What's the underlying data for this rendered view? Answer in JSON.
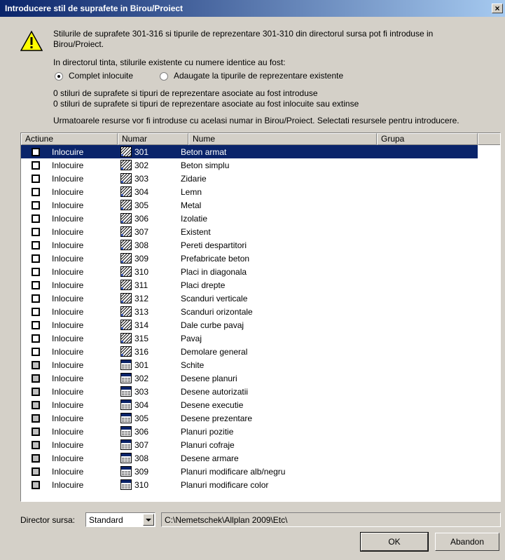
{
  "window": {
    "title": "Introducere stil de suprafete in Birou/Proiect",
    "close": "×"
  },
  "info": {
    "line1": "Stilurile de suprafete 301-316 si tipurile de reprezentare 301-310 din directorul sursa pot fi introduse in",
    "line2": "Birou/Proiect.",
    "line3": "In directorul tinta, stilurile existente cu numere identice au fost:",
    "radio1": "Complet inlocuite",
    "radio2": "Adaugate la tipurile de reprezentare existente",
    "status1": "0 stiluri de suprafete si tipuri de reprezentare asociate au fost introduse",
    "status2": "0 stiluri de suprafete si tipuri de reprezentare asociate au fost inlocuite sau extinse",
    "prompt": "Urmatoarele resurse vor fi introduse cu acelasi numar in Birou/Proiect. Selectati resursele pentru introducere."
  },
  "table": {
    "columns": [
      "Actiune",
      "Numar",
      "Nume",
      "Grupa"
    ],
    "rows": [
      {
        "action": "Inlocuire",
        "number": "301",
        "name": "Beton armat",
        "icon": "hatch-icon"
      },
      {
        "action": "Inlocuire",
        "number": "302",
        "name": "Beton simplu",
        "icon": "hatch-icon"
      },
      {
        "action": "Inlocuire",
        "number": "303",
        "name": "Zidarie",
        "icon": "hatch-icon"
      },
      {
        "action": "Inlocuire",
        "number": "304",
        "name": "Lemn",
        "icon": "hatch-icon"
      },
      {
        "action": "Inlocuire",
        "number": "305",
        "name": "Metal",
        "icon": "hatch-icon"
      },
      {
        "action": "Inlocuire",
        "number": "306",
        "name": "Izolatie",
        "icon": "hatch-icon"
      },
      {
        "action": "Inlocuire",
        "number": "307",
        "name": "Existent",
        "icon": "hatch-icon"
      },
      {
        "action": "Inlocuire",
        "number": "308",
        "name": "Pereti despartitori",
        "icon": "hatch-icon"
      },
      {
        "action": "Inlocuire",
        "number": "309",
        "name": "Prefabricate beton",
        "icon": "hatch-icon"
      },
      {
        "action": "Inlocuire",
        "number": "310",
        "name": "Placi in diagonala",
        "icon": "hatch-icon"
      },
      {
        "action": "Inlocuire",
        "number": "311",
        "name": "Placi drepte",
        "icon": "hatch-icon"
      },
      {
        "action": "Inlocuire",
        "number": "312",
        "name": "Scanduri verticale",
        "icon": "hatch-icon"
      },
      {
        "action": "Inlocuire",
        "number": "313",
        "name": "Scanduri orizontale",
        "icon": "hatch-icon"
      },
      {
        "action": "Inlocuire",
        "number": "314",
        "name": "Dale curbe pavaj",
        "icon": "hatch-icon"
      },
      {
        "action": "Inlocuire",
        "number": "315",
        "name": "Pavaj",
        "icon": "hatch-icon"
      },
      {
        "action": "Inlocuire",
        "number": "316",
        "name": "Demolare general",
        "icon": "hatch-icon"
      },
      {
        "action": "Inlocuire",
        "number": "301",
        "name": "Schite",
        "icon": "display-type-icon"
      },
      {
        "action": "Inlocuire",
        "number": "302",
        "name": "Desene planuri",
        "icon": "display-type-icon"
      },
      {
        "action": "Inlocuire",
        "number": "303",
        "name": "Desene autorizatii",
        "icon": "display-type-icon"
      },
      {
        "action": "Inlocuire",
        "number": "304",
        "name": "Desene executie",
        "icon": "display-type-icon"
      },
      {
        "action": "Inlocuire",
        "number": "305",
        "name": "Desene prezentare",
        "icon": "display-type-icon"
      },
      {
        "action": "Inlocuire",
        "number": "306",
        "name": "Planuri pozitie",
        "icon": "display-type-icon"
      },
      {
        "action": "Inlocuire",
        "number": "307",
        "name": "Planuri cofraje",
        "icon": "display-type-icon"
      },
      {
        "action": "Inlocuire",
        "number": "308",
        "name": "Desene armare",
        "icon": "display-type-icon"
      },
      {
        "action": "Inlocuire",
        "number": "309",
        "name": "Planuri modificare alb/negru",
        "icon": "display-type-icon"
      },
      {
        "action": "Inlocuire",
        "number": "310",
        "name": "Planuri modificare color",
        "icon": "display-type-icon"
      }
    ]
  },
  "source": {
    "label": "Director sursa:",
    "value": "Standard",
    "path": "C:\\Nemetschek\\Allplan 2009\\Etc\\"
  },
  "buttons": {
    "ok": "OK",
    "cancel": "Abandon"
  }
}
